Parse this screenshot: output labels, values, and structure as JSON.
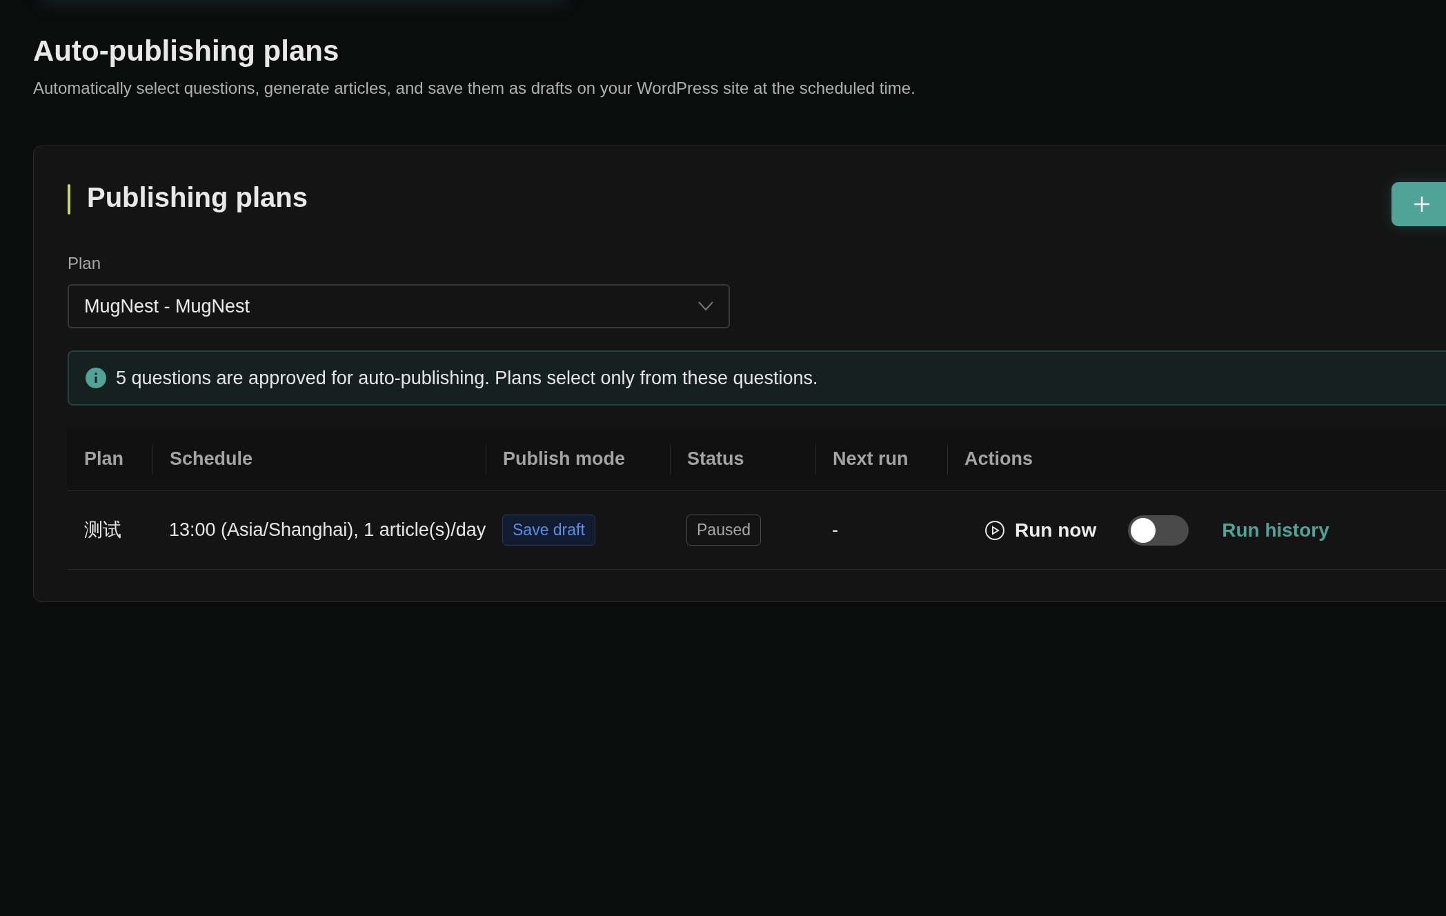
{
  "page": {
    "title": "Auto-publishing plans",
    "subtitle": "Automatically select questions, generate articles, and save them as drafts on your WordPress site at the scheduled time."
  },
  "card": {
    "title": "Publishing plans",
    "plan_field": {
      "label": "Plan",
      "value": "MugNest - MugNest"
    },
    "notice": "5 questions are approved for auto-publishing. Plans select only from these questions.",
    "table": {
      "columns": [
        "Plan",
        "Schedule",
        "Publish mode",
        "Status",
        "Next run",
        "Actions"
      ],
      "rows": [
        {
          "plan": "测试",
          "schedule": "13:00 (Asia/Shanghai), 1 article(s)/day",
          "publish_mode": "Save draft",
          "status": "Paused",
          "next_run": "-",
          "run_now": "Run now",
          "on": false,
          "run_history": "Run history"
        }
      ]
    }
  }
}
